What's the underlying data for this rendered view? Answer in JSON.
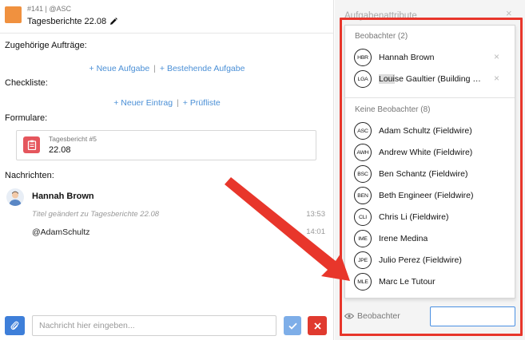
{
  "task": {
    "id_line": "#141 | @ASC",
    "title": "Tagesberichte 22.08"
  },
  "sections": {
    "related_tasks": "Zugehörige Aufträge:",
    "new_task": "+ Neue Aufgabe",
    "existing_task": "+ Bestehende Aufgabe",
    "checklist": "Checkliste:",
    "new_entry": "+ Neuer Eintrag",
    "checklist_link": "+ Prüfliste",
    "forms": "Formulare:",
    "messages": "Nachrichten:",
    "link_separator": "|"
  },
  "form": {
    "label": "Tagesbericht #5",
    "value": "22.08"
  },
  "messages": [
    {
      "author": "Hannah Brown",
      "system_text": "Titel geändert zu Tagesberichte 22.08",
      "system_time": "13:53",
      "text": "@AdamSchultz",
      "time": "14:01"
    }
  ],
  "composer": {
    "placeholder": "Nachricht hier eingeben..."
  },
  "panel": {
    "title": "Aufgabenattribute",
    "close": "×"
  },
  "watchers": {
    "group1_label": "Beobachter (2)",
    "group2_label": "Keine Beobachter (8)",
    "selected": [
      {
        "initials": "HBR",
        "name": "Hannah Brown"
      },
      {
        "initials": "LGA",
        "name_highlight": "Loui",
        "name_rest": "se Gaultier (Building C..."
      }
    ],
    "others": [
      {
        "initials": "ASC",
        "name": "Adam Schultz (Fieldwire)"
      },
      {
        "initials": "AWH",
        "name": "Andrew White (Fieldwire)"
      },
      {
        "initials": "BSC",
        "name": "Ben Schantz (Fieldwire)"
      },
      {
        "initials": "BEN",
        "name": "Beth Engineer (Fieldwire)"
      },
      {
        "initials": "CLI",
        "name": "Chris Li (Fieldwire)"
      },
      {
        "initials": "IME",
        "name": "Irene Medina"
      },
      {
        "initials": "JPE",
        "name": "Julio Perez (Fieldwire)"
      },
      {
        "initials": "MLE",
        "name": "Marc Le Tutour"
      }
    ],
    "remove_symbol": "×",
    "field_label": "Beobachter"
  },
  "colors": {
    "task_swatch": "#f0913f",
    "link": "#4a8fd6",
    "form_icon": "#e5565d",
    "attach_button": "#3e7fd9",
    "confirm_button": "#7eaee8",
    "cancel_button": "#e03a2f",
    "annotation": "#e8362b"
  }
}
